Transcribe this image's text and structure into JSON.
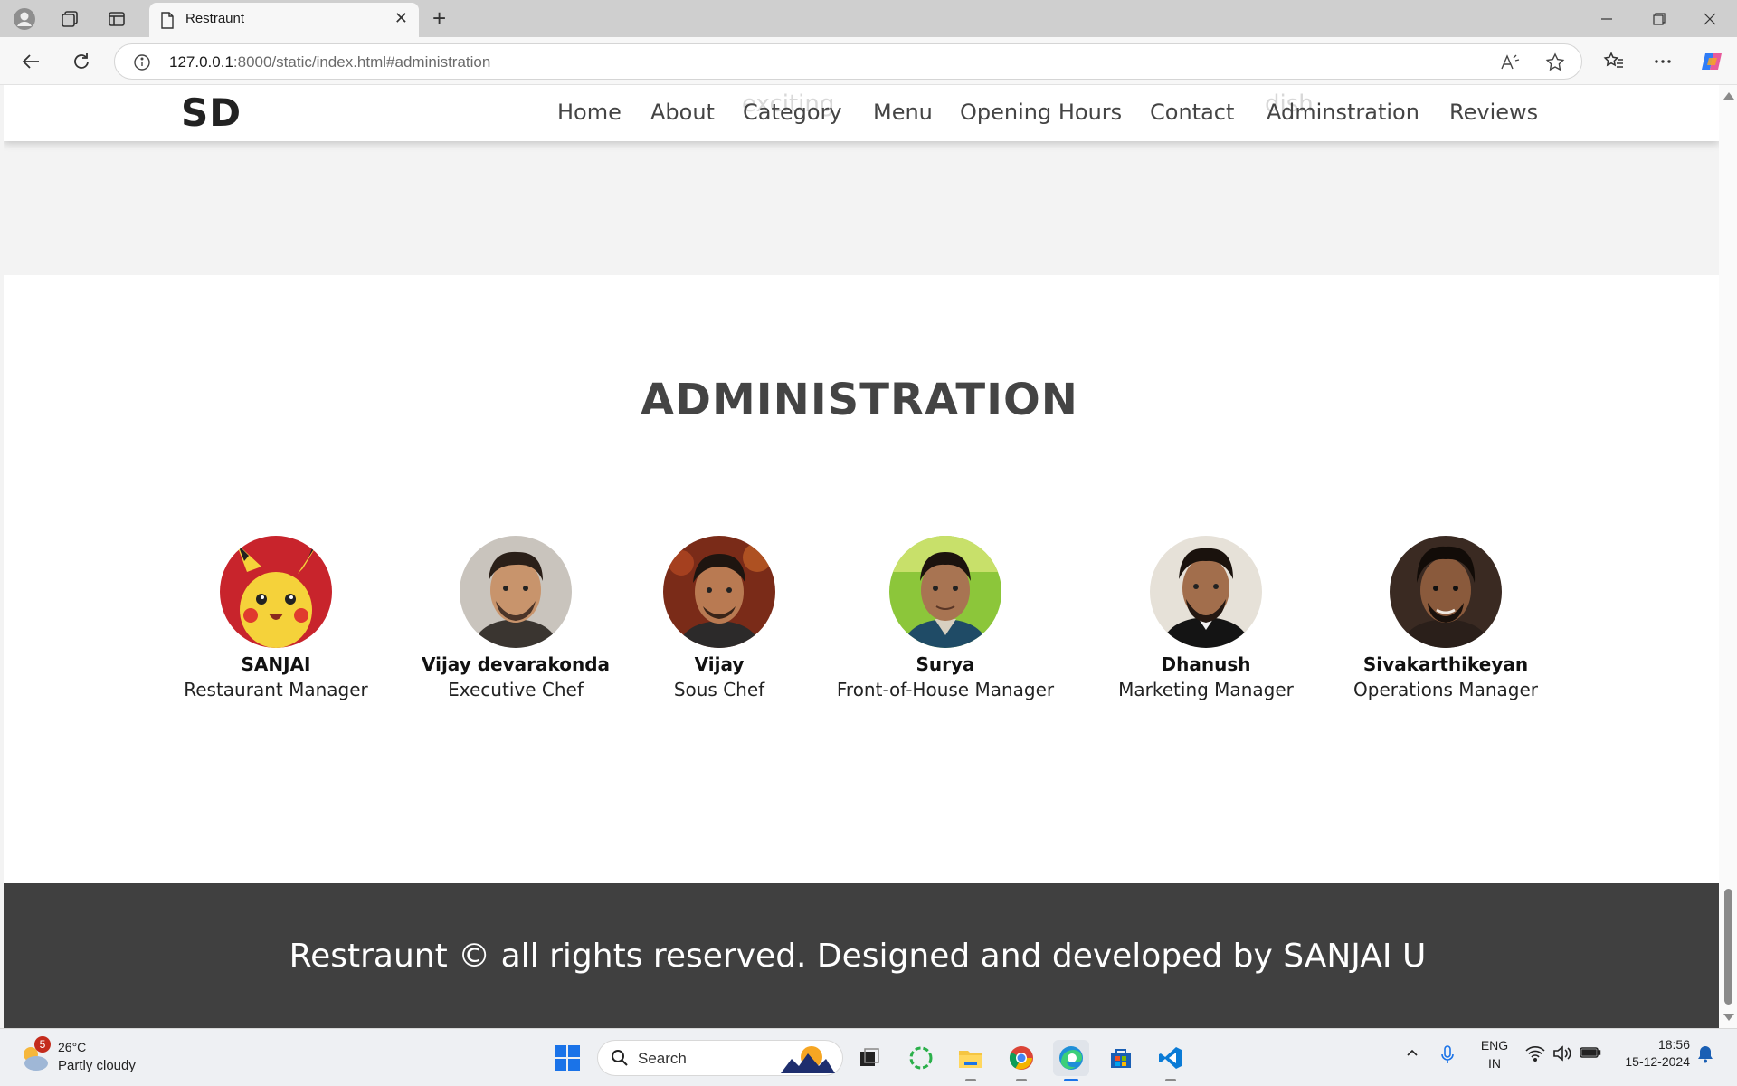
{
  "browser": {
    "tab_title": "Restraunt",
    "close_glyph": "✕",
    "new_tab_glyph": "+",
    "url_host": "127.0.0.1",
    "url_rest": ":8000/static/index.html#administration"
  },
  "site": {
    "logo": "SD",
    "nav": [
      "Home",
      "About",
      "Category",
      "Menu",
      "Opening Hours",
      "Contact",
      "Adminstration",
      "Reviews"
    ],
    "ghost_text": [
      "exciting",
      "dish"
    ]
  },
  "section": {
    "title": "ADMINISTRATION",
    "members": [
      {
        "name": "SANJAI",
        "role": "Restaurant Manager"
      },
      {
        "name": "Vijay devarakonda",
        "role": "Executive Chef"
      },
      {
        "name": "Vijay",
        "role": "Sous Chef"
      },
      {
        "name": "Surya",
        "role": "Front-of-House Manager"
      },
      {
        "name": "Dhanush",
        "role": "Marketing Manager"
      },
      {
        "name": "Sivakarthikeyan",
        "role": "Operations Manager"
      }
    ]
  },
  "footer": {
    "text": "Restraunt © all rights reserved. Designed and developed by SANJAI U"
  },
  "taskbar": {
    "weather_temp": "26°C",
    "weather_desc": "Partly cloudy",
    "weather_badge": "5",
    "search_placeholder": "Search",
    "lang_line1": "ENG",
    "lang_line2": "IN",
    "time": "18:56",
    "date": "15-12-2024"
  },
  "colors": {
    "footer_bg": "#404040",
    "band_bg": "#f3f3f3",
    "title_text": "#444444"
  }
}
